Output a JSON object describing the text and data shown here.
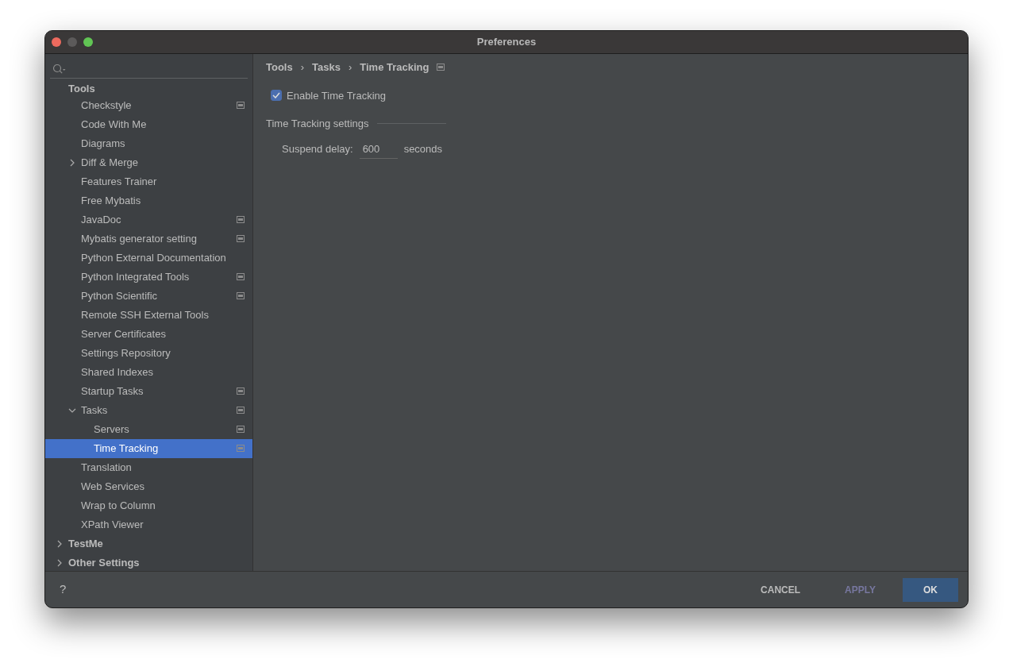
{
  "window": {
    "title": "Preferences"
  },
  "sidebar": {
    "items": [
      {
        "label": "Tools",
        "selected": false,
        "project_icon": false,
        "children": [
          {
            "label": "Checkstyle",
            "selected": false,
            "project_icon": true
          },
          {
            "label": "Code With Me",
            "selected": false,
            "project_icon": false
          },
          {
            "label": "Diagrams",
            "selected": false,
            "project_icon": false
          },
          {
            "label": "Diff & Merge",
            "selected": false,
            "expanded": false,
            "project_icon": false
          },
          {
            "label": "Features Trainer",
            "selected": false,
            "project_icon": false
          },
          {
            "label": "Free Mybatis",
            "selected": false,
            "project_icon": false
          },
          {
            "label": "JavaDoc",
            "selected": false,
            "project_icon": true
          },
          {
            "label": "Mybatis generator setting",
            "selected": false,
            "project_icon": true
          },
          {
            "label": "Python External Documentation",
            "selected": false,
            "project_icon": false
          },
          {
            "label": "Python Integrated Tools",
            "selected": false,
            "project_icon": true
          },
          {
            "label": "Python Scientific",
            "selected": false,
            "project_icon": true
          },
          {
            "label": "Remote SSH External Tools",
            "selected": false,
            "project_icon": false
          },
          {
            "label": "Server Certificates",
            "selected": false,
            "project_icon": false
          },
          {
            "label": "Settings Repository",
            "selected": false,
            "project_icon": false
          },
          {
            "label": "Shared Indexes",
            "selected": false,
            "project_icon": false
          },
          {
            "label": "Startup Tasks",
            "selected": false,
            "project_icon": true
          },
          {
            "label": "Tasks",
            "selected": false,
            "expanded": true,
            "project_icon": true,
            "children": [
              {
                "label": "Servers",
                "selected": false,
                "project_icon": true
              },
              {
                "label": "Time Tracking",
                "selected": true,
                "project_icon": true
              }
            ]
          },
          {
            "label": "Translation",
            "selected": false,
            "project_icon": false
          },
          {
            "label": "Web Services",
            "selected": false,
            "project_icon": false
          },
          {
            "label": "Wrap to Column",
            "selected": false,
            "project_icon": false
          },
          {
            "label": "XPath Viewer",
            "selected": false,
            "project_icon": false
          }
        ]
      },
      {
        "label": "TestMe",
        "selected": false,
        "expanded": false,
        "project_icon": false
      },
      {
        "label": "Other Settings",
        "selected": false,
        "expanded": false,
        "project_icon": false
      }
    ]
  },
  "breadcrumbs": [
    "Tools",
    "Tasks",
    "Time Tracking"
  ],
  "breadcrumb_separator": "›",
  "breadcrumb_project_icon": true,
  "enable_checkbox": {
    "label": "Enable Time Tracking",
    "checked": true
  },
  "section": {
    "title": "Time Tracking settings"
  },
  "suspend_delay": {
    "label": "Suspend delay:",
    "value": "600",
    "unit": "seconds"
  },
  "footer": {
    "help": "?",
    "buttons": [
      {
        "label": "CANCEL",
        "kind": "plain",
        "disabled": false
      },
      {
        "label": "APPLY",
        "kind": "plain",
        "disabled": true
      },
      {
        "label": "OK",
        "kind": "primary",
        "disabled": false
      }
    ]
  }
}
